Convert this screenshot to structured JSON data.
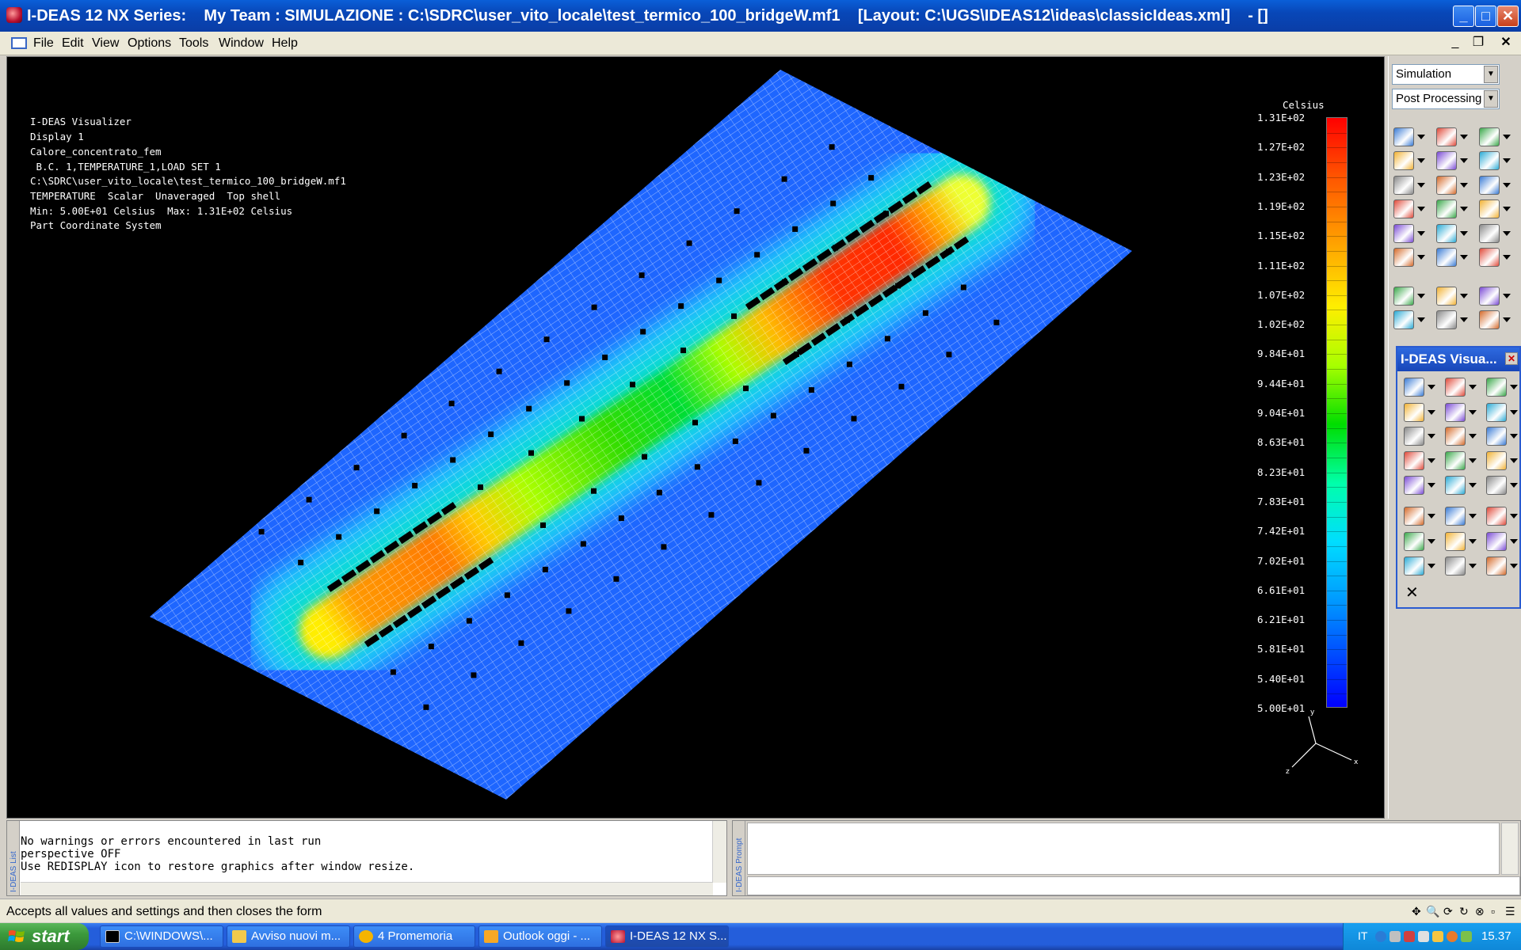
{
  "window": {
    "title": "I-DEAS 12 NX Series:    My Team : SIMULAZIONE : C:\\SDRC\\user_vito_locale\\test_termico_100_bridgeW.mf1    [Layout: C:\\UGS\\IDEAS12\\ideas\\classicIdeas.xml]    - []",
    "minimize": "_",
    "maximize": "□",
    "close": "✕"
  },
  "menu": [
    "File",
    "Edit",
    "View",
    "Options",
    "Tools",
    "Window",
    "Help"
  ],
  "mdi_controls": {
    "minimize": "_",
    "restore": "❐",
    "close": "✕"
  },
  "viewport_info": [
    "I-DEAS Visualizer",
    "Display 1",
    "Calore_concentrato_fem",
    " B.C. 1,TEMPERATURE_1,LOAD SET 1",
    "C:\\SDRC\\user_vito_locale\\test_termico_100_bridgeW.mf1",
    "TEMPERATURE  Scalar  Unaveraged  Top shell",
    "Min: 5.00E+01 Celsius  Max: 1.31E+02 Celsius",
    "Part Coordinate System"
  ],
  "legend": {
    "title": "Celsius",
    "ticks": [
      "1.31E+02",
      "1.27E+02",
      "1.23E+02",
      "1.19E+02",
      "1.15E+02",
      "1.11E+02",
      "1.07E+02",
      "1.02E+02",
      "9.84E+01",
      "9.44E+01",
      "9.04E+01",
      "8.63E+01",
      "8.23E+01",
      "7.83E+01",
      "7.42E+01",
      "7.02E+01",
      "6.61E+01",
      "6.21E+01",
      "5.81E+01",
      "5.40E+01",
      "5.00E+01"
    ],
    "colors": {
      "max": "#ff0000",
      "mid": "#00dd00",
      "min": "#0000ff"
    }
  },
  "triad": {
    "x": "x",
    "y": "y",
    "z": "z"
  },
  "task_dropdowns": {
    "application": "Simulation",
    "task": "Post Processing"
  },
  "palette": {
    "title": "I-DEAS Visua...",
    "close": "✕"
  },
  "list_window": {
    "side_label": "I-DEAS List",
    "lines": [
      "No warnings or errors encountered in last run",
      "perspective OFF",
      "Use REDISPLAY icon to restore graphics after window resize."
    ]
  },
  "prompt_window": {
    "side_label": "I-DEAS Prompt"
  },
  "status_bar": {
    "text": "Accepts all values and settings and then closes the form"
  },
  "taskbar": {
    "start": "start",
    "buttons": [
      "C:\\WINDOWS\\...",
      "Avviso nuovi m...",
      "4 Promemoria",
      "Outlook oggi - ...",
      "I-DEAS 12 NX S..."
    ],
    "language": "IT",
    "clock": "15.37"
  }
}
